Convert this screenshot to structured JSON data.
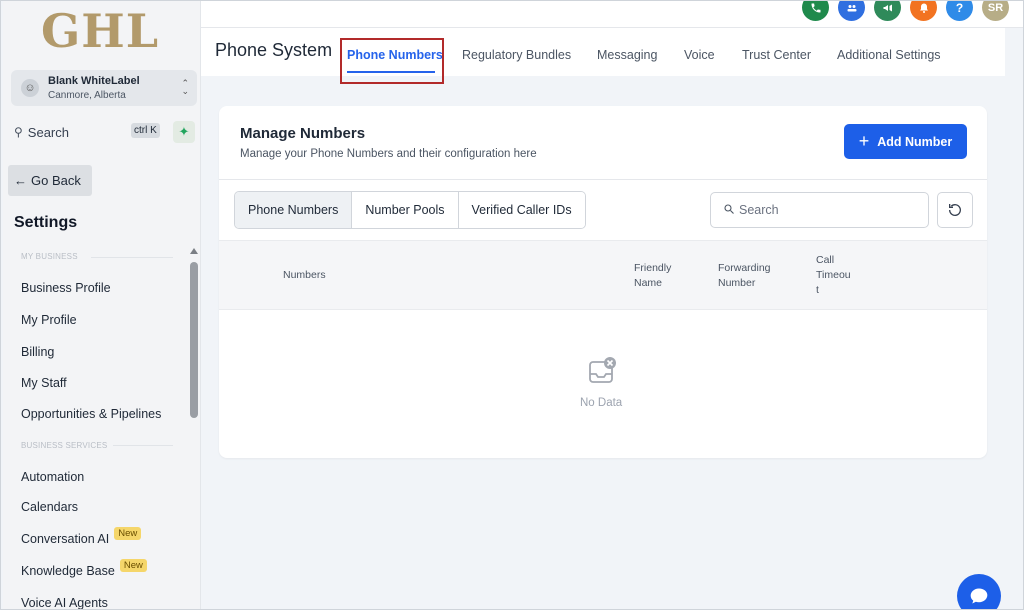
{
  "logo": "GHL",
  "account": {
    "name": "Blank WhiteLabel",
    "location": "Canmore, Alberta"
  },
  "sidebar_search": {
    "label": "Search",
    "shortcut": "ctrl K"
  },
  "go_back": "Go Back",
  "settings_title": "Settings",
  "sections": {
    "my_business": "MY BUSINESS",
    "business_services": "BUSINESS SERVICES"
  },
  "menu": {
    "business_profile": "Business Profile",
    "my_profile": "My Profile",
    "billing": "Billing",
    "my_staff": "My Staff",
    "opportunities": "Opportunities & Pipelines",
    "automation": "Automation",
    "calendars": "Calendars",
    "conversation_ai": "Conversation AI",
    "knowledge_base": "Knowledge Base",
    "voice_ai_agents": "Voice AI Agents",
    "new_badge": "New"
  },
  "top_icons": {
    "avatar_initials": "SR",
    "help": "?",
    "colors": {
      "phone": "#1f8a4c",
      "contacts": "#2f6fe0",
      "megaphone": "#2f8a5a",
      "bell": "#f27321",
      "help": "#2f8be8",
      "avatar": "#b7ad87"
    }
  },
  "header": {
    "title": "Phone System",
    "tabs": {
      "phone_numbers": "Phone Numbers",
      "regulatory_bundles": "Regulatory Bundles",
      "messaging": "Messaging",
      "voice": "Voice",
      "trust_center": "Trust Center",
      "additional_settings": "Additional Settings"
    }
  },
  "card": {
    "title": "Manage Numbers",
    "subtitle": "Manage your Phone Numbers and their configuration here",
    "add_button": "Add Number",
    "segments": {
      "phone_numbers": "Phone Numbers",
      "number_pools": "Number Pools",
      "verified_caller_ids": "Verified Caller IDs"
    },
    "search_placeholder": "Search",
    "columns": {
      "numbers": "Numbers",
      "friendly_name_1": "Friendly",
      "friendly_name_2": "Name",
      "forwarding_1": "Forwarding",
      "forwarding_2": "Number",
      "call_timeout_1": "Call",
      "call_timeout_2": "Timeou",
      "call_timeout_3": "t"
    },
    "empty_text": "No Data"
  },
  "accent_color": "#1d5fe8"
}
